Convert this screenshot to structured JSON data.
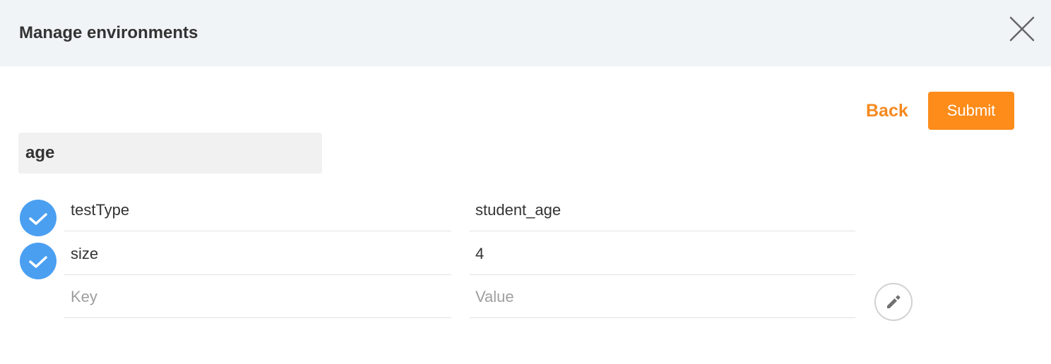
{
  "header": {
    "title": "Manage environments"
  },
  "actions": {
    "back_label": "Back",
    "submit_label": "Submit"
  },
  "environment": {
    "name": "age"
  },
  "variables": [
    {
      "key": "testType",
      "value": "student_age",
      "enabled": true
    },
    {
      "key": "size",
      "value": "4",
      "enabled": true
    }
  ],
  "new_variable": {
    "key_placeholder": "Key",
    "value_placeholder": "Value"
  },
  "colors": {
    "accent": "#fd8c1a",
    "check": "#4a9ff1",
    "header_bg": "#f0f4f7"
  },
  "icons": {
    "close": "close-icon",
    "check": "check-icon",
    "edit": "pencil-icon"
  }
}
